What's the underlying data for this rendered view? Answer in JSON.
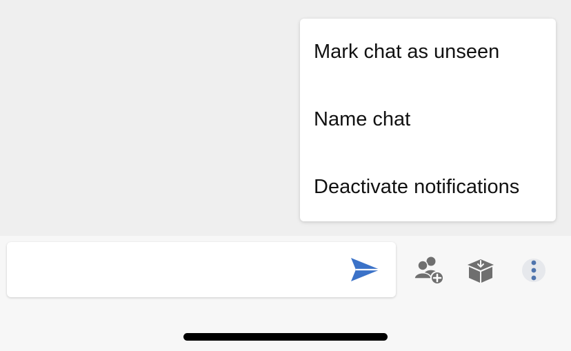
{
  "colors": {
    "accent": "#3b72c8",
    "icon_gray": "#6f6f6f",
    "menu_text": "#111111",
    "background": "#efefef"
  },
  "context_menu": {
    "items": [
      {
        "label": "Mark chat as unseen"
      },
      {
        "label": "Name chat"
      },
      {
        "label": "Deactivate notifications"
      }
    ]
  },
  "composer": {
    "value": "",
    "placeholder": ""
  },
  "toolbar": {
    "send_icon": "send-icon",
    "add_member_icon": "add-member-icon",
    "archive_icon": "archive-box-icon",
    "more_icon": "more-vertical-icon"
  }
}
